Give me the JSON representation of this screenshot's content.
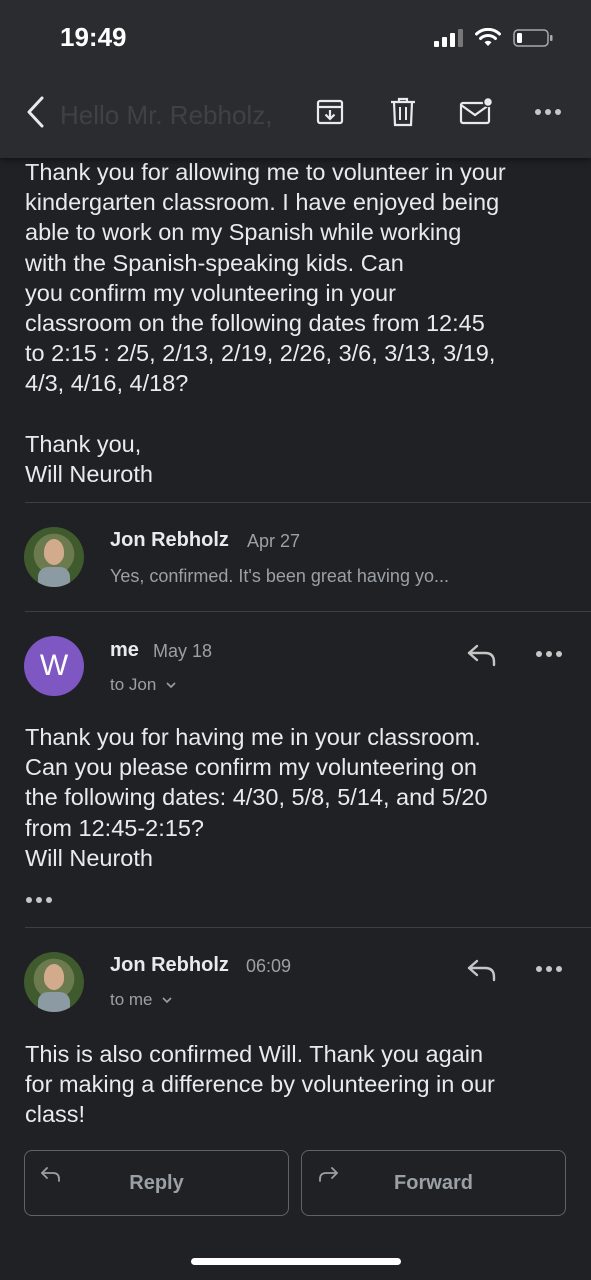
{
  "status_bar": {
    "time": "19:49"
  },
  "toolbar": {
    "ghost_text": "Hello Mr. Rebholz,"
  },
  "message1": {
    "body": "Thank you for allowing me to volunteer in your\nkindergarten classroom. I have enjoyed being\nable to work on my Spanish while working\nwith the Spanish-speaking kids. Can\nyou confirm my volunteering in your\nclassroom on the following dates from 12:45\nto 2:15 : 2/5, 2/13, 2/19, 2/26, 3/6, 3/13, 3/19,\n4/3, 4/16, 4/18?\n\nThank you,\nWill Neuroth"
  },
  "collapsed": {
    "sender": "Jon Rebholz",
    "date": "Apr 27",
    "snippet": "Yes, confirmed. It's been great having yo..."
  },
  "message2": {
    "avatar_letter": "W",
    "sender": "me",
    "date": "May 18",
    "recipient": "to Jon",
    "body": "Thank you for having me in your classroom.\nCan you please confirm my volunteering on\nthe following dates: 4/30, 5/8, 5/14, and 5/20\nfrom 12:45-2:15?\nWill Neuroth"
  },
  "message3": {
    "sender": "Jon Rebholz",
    "date": "06:09",
    "recipient": "to me",
    "body": "This is also confirmed Will. Thank you again\nfor making a difference by volunteering in our\nclass!"
  },
  "actions": {
    "reply": "Reply",
    "forward": "Forward"
  },
  "colors": {
    "background": "#202124",
    "avatar_w": "#7e57c2",
    "topbar": "#2b2c2f"
  },
  "icons": [
    "back-arrow-icon",
    "archive-icon",
    "trash-icon",
    "mark-unread-icon",
    "more-icon",
    "reply-icon",
    "forward-icon"
  ]
}
